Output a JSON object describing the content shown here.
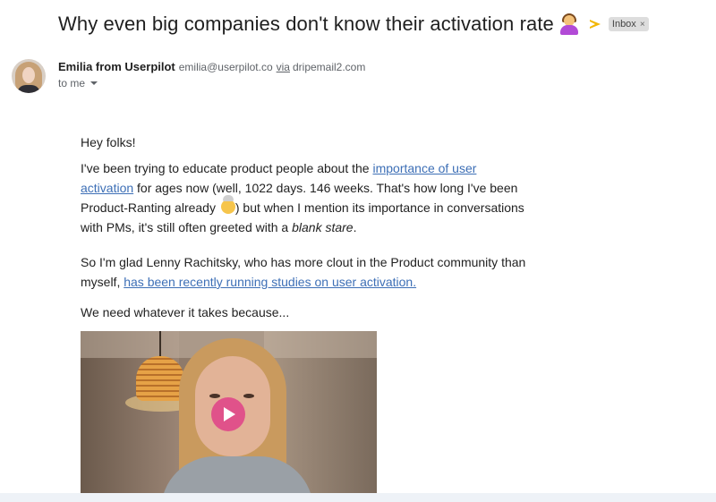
{
  "email": {
    "subject": "Why even big companies don't know their activation rate",
    "label": "Inbox",
    "label_close": "×",
    "sender_name": "Emilia from Userpilot",
    "sender_email": "emilia@userpilot.co",
    "via_text": "via",
    "via_domain": "dripemail2.com",
    "recipient": "to me"
  },
  "body": {
    "greeting": "Hey folks!",
    "p2_part1": "I've been trying to educate product people about the ",
    "p2_link": "importance of user activation",
    "p2_part2": " for ages now (well, 1022 days. 146 weeks. That's how long I've been Product-Ranting already ",
    "p2_part3": ") but when I mention its importance in conversations with PMs, it's still often greeted with a ",
    "p2_italic": "blank stare",
    "p2_end": ".",
    "p3_part1": "So I'm glad Lenny Rachitsky, who has more clout in the Product community than myself, ",
    "p3_link": "has been recently running studies on user activation. ",
    "p4": "We need whatever it takes because..."
  },
  "icons": {
    "subject_emoji": "person-shrugging-emoji",
    "importance": "importance-marker-icon",
    "mind_blown": "mind-blown-emoji",
    "play": "play-icon"
  },
  "colors": {
    "link": "#3d6fb6",
    "importance": "#f2b705",
    "play_button": "#e0528a",
    "label_chip": "#dddddd"
  }
}
